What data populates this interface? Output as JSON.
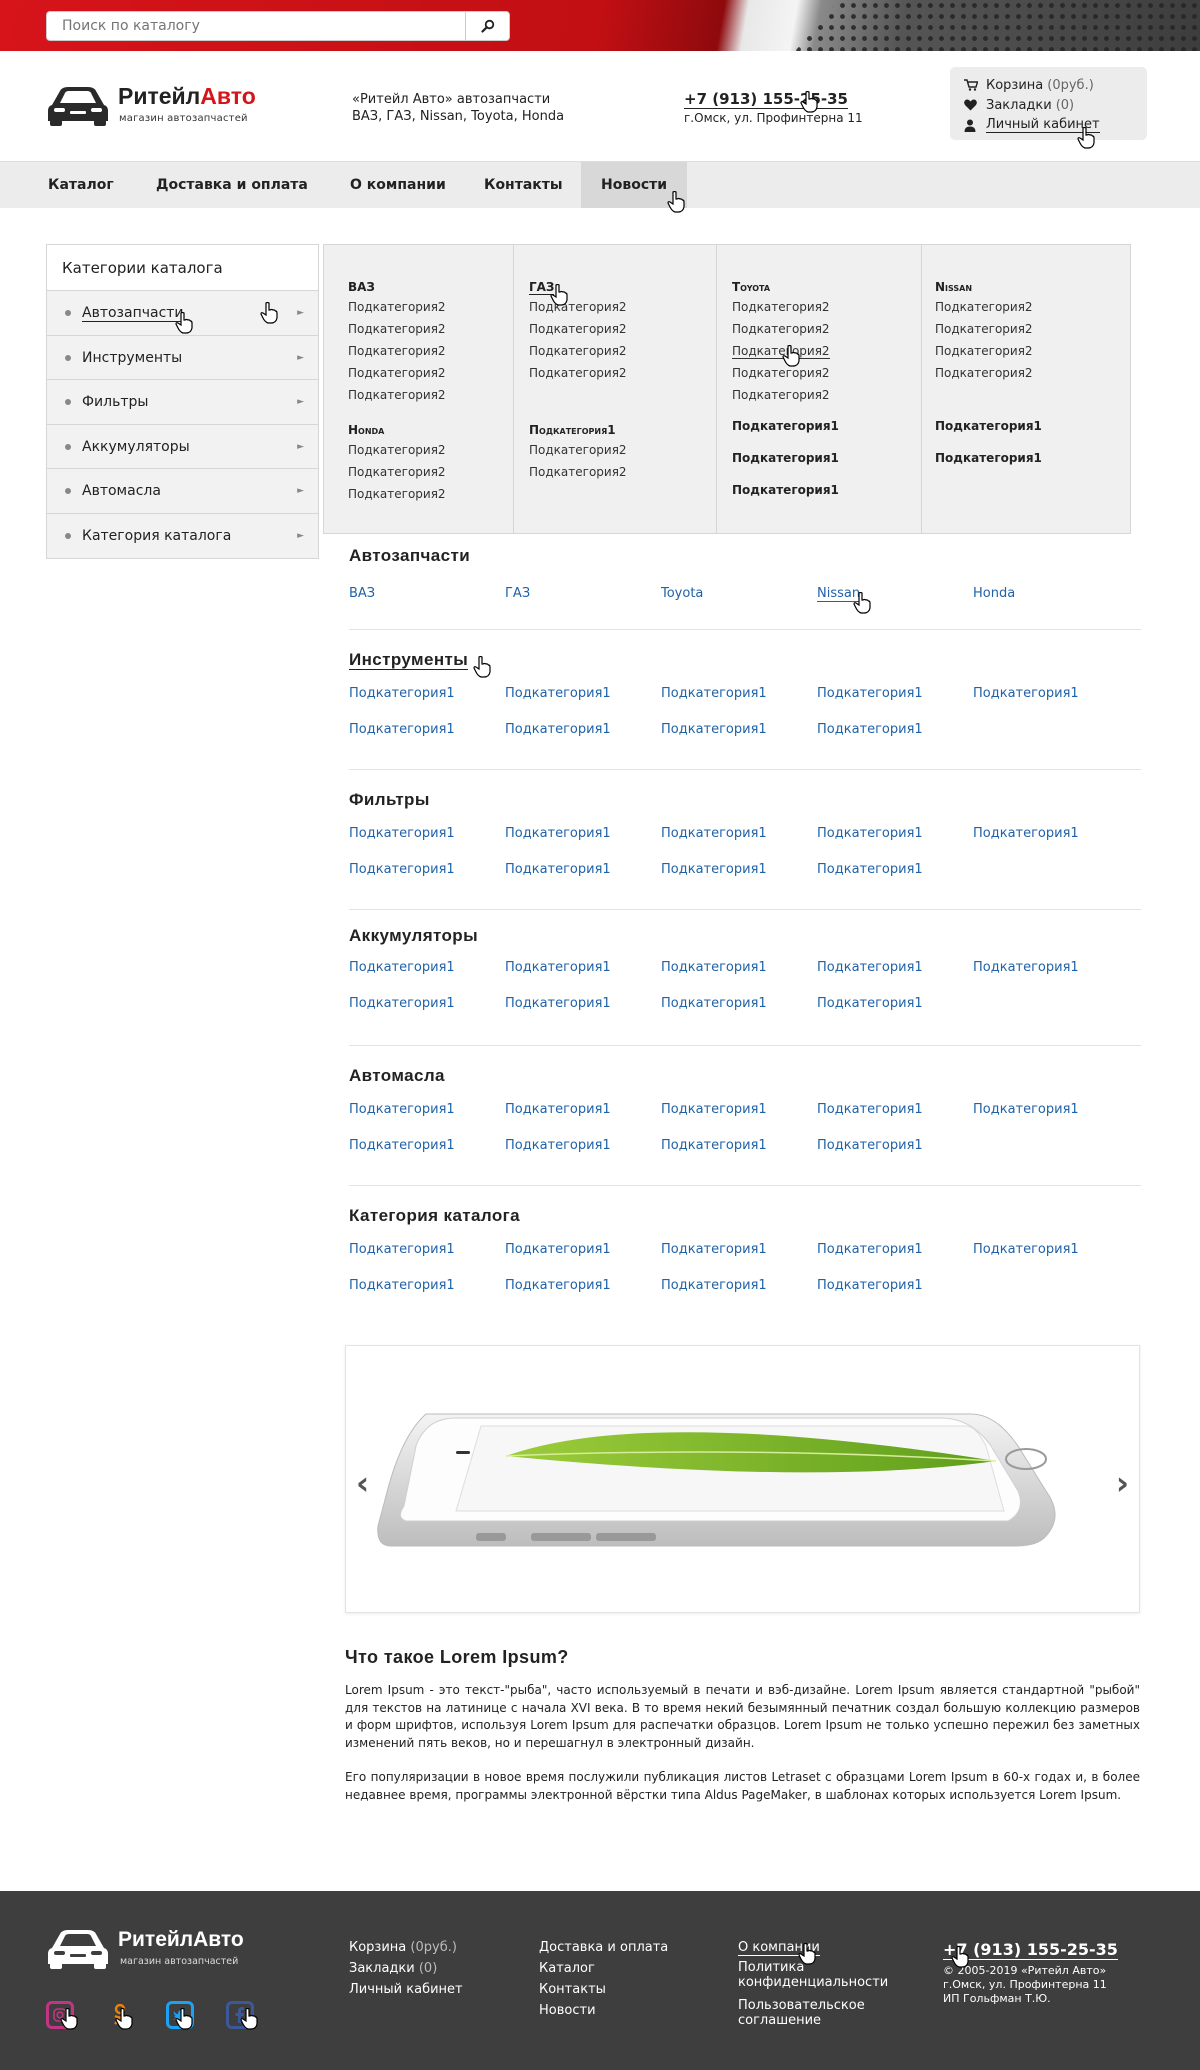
{
  "search": {
    "placeholder": "Поиск по каталогу"
  },
  "brand": {
    "name_black": "Ритейл",
    "name_red": "Авто",
    "tagline": "магазин автозапчастей"
  },
  "header": {
    "about_line1": "«Ритейл Авто» автозапчасти",
    "about_line2": "ВАЗ, ГАЗ, Nissan, Toyota, Honda",
    "phone": "+7 (913) 155-25-35",
    "address": "г.Омск, ул. Профинтерна 11"
  },
  "user": {
    "cart_label": "Корзина",
    "cart_value": "(0руб.)",
    "bookmarks_label": "Закладки",
    "bookmarks_value": "(0)",
    "account_label": "Личный кабинет"
  },
  "nav": [
    "Каталог",
    "Доставка и оплата",
    "О компании",
    "Контакты",
    "Новости"
  ],
  "sidebar": {
    "title": "Категории каталога",
    "items": [
      "Автозапчасти",
      "Инструменты",
      "Фильтры",
      "Аккумуляторы",
      "Автомасла",
      "Категория каталога"
    ]
  },
  "dropdown": {
    "cols": [
      {
        "groups": [
          {
            "title": "ВАЗ",
            "links": [
              "Подкатегория2",
              "Подкатегория2",
              "Подкатегория2",
              "Подкатегория2",
              "Подкатегория2"
            ]
          },
          {
            "title": "Honda",
            "links": [
              "Подкатегория2",
              "Подкатегория2",
              "Подкатегория2"
            ]
          }
        ]
      },
      {
        "groups": [
          {
            "title": "ГАЗ",
            "links": [
              "Подкатегория2",
              "Подкатегория2",
              "Подкатегория2",
              "Подкатегория2"
            ]
          },
          {
            "title": "Подкатегория1",
            "links": [
              "Подкатегория2",
              "Подкатегория2"
            ]
          }
        ]
      },
      {
        "groups": [
          {
            "title": "Toyota",
            "links": [
              "Подкатегория2",
              "Подкатегория2",
              "Подкатегория2",
              "Подкатегория2",
              "Подкатегория2"
            ]
          }
        ],
        "extra": [
          "Подкатегория1",
          "Подкатегория1",
          "Подкатегория1"
        ]
      },
      {
        "groups": [
          {
            "title": "Nissan",
            "links": [
              "Подкатегория2",
              "Подкатегория2",
              "Подкатегория2",
              "Подкатегория2"
            ]
          }
        ],
        "extra": [
          "Подкатегория1",
          "Подкатегория1"
        ]
      }
    ]
  },
  "sections": [
    {
      "title": "Автозапчасти",
      "links": [
        "ВАЗ",
        "ГАЗ",
        "Toyota",
        "Nissan",
        "Honda"
      ]
    },
    {
      "title": "Инструменты",
      "links": [
        "Подкатегория1",
        "Подкатегория1",
        "Подкатегория1",
        "Подкатегория1",
        "Подкатегория1",
        "Подкатегория1",
        "Подкатегория1",
        "Подкатегория1",
        "Подкатегория1"
      ]
    },
    {
      "title": "Фильтры",
      "links": [
        "Подкатегория1",
        "Подкатегория1",
        "Подкатегория1",
        "Подкатегория1",
        "Подкатегория1",
        "Подкатегория1",
        "Подкатегория1",
        "Подкатегория1",
        "Подкатегория1"
      ]
    },
    {
      "title": "Аккумуляторы",
      "links": [
        "Подкатегория1",
        "Подкатегория1",
        "Подкатегория1",
        "Подкатегория1",
        "Подкатегория1",
        "Подкатегория1",
        "Подкатегория1",
        "Подкатегория1",
        "Подкатегория1"
      ]
    },
    {
      "title": "Автомасла",
      "links": [
        "Подкатегория1",
        "Подкатегория1",
        "Подкатегория1",
        "Подкатегория1",
        "Подкатегория1",
        "Подкатегория1",
        "Подкатегория1",
        "Подкатегория1",
        "Подкатегория1"
      ]
    },
    {
      "title": "Категория каталога",
      "links": [
        "Подкатегория1",
        "Подкатегория1",
        "Подкатегория1",
        "Подкатегория1",
        "Подкатегория1",
        "Подкатегория1",
        "Подкатегория1",
        "Подкатегория1",
        "Подкатегория1"
      ]
    }
  ],
  "slider": {
    "prev": "‹",
    "next": "›"
  },
  "about": {
    "title": "Что такое Lorem Ipsum?",
    "p1": "Lorem Ipsum - это текст-\"рыба\", часто используемый в печати и вэб-дизайне. Lorem Ipsum является стандартной \"рыбой\" для текстов на латинице с начала XVI века. В то время некий безымянный печатник создал большую коллекцию размеров и форм шрифтов, используя Lorem Ipsum для распечатки образцов. Lorem Ipsum не только успешно пережил без заметных изменений пять веков, но и перешагнул в электронный дизайн.",
    "p2": "Его популяризации в новое время послужили публикация листов Letraset с образцами Lorem Ipsum в 60-х годах и, в более недавнее время, программы электронной вёрстки типа Aldus PageMaker, в шаблонах которых используется Lorem Ipsum."
  },
  "footer": {
    "brand": "РитейлАвто",
    "tagline": "магазин автозапчастей",
    "col1": {
      "cart_label": "Корзина",
      "cart_value": "(0руб.)",
      "bookmarks_label": "Закладки",
      "bookmarks_value": "(0)",
      "account": "Личный кабинет"
    },
    "col2": [
      "Доставка и оплата",
      "Каталог",
      "Контакты",
      "Новости"
    ],
    "col3": [
      "О компании",
      "Политика конфиденциальности",
      "Пользовательское соглашение"
    ],
    "phone": "+7 (913) 155-25-35",
    "copyright": "© 2005-2019 «Ритейл Авто»",
    "address": "г.Омск, ул. Профинтерна 11",
    "owner": "ИП Гольфман Т.Ю."
  },
  "colors": {
    "accent_red": "#d6141a",
    "link_blue": "#1f62a8",
    "footer_bg": "#3e3e3e",
    "nav_bg": "#ececec"
  },
  "socials": [
    {
      "icon": "instagram-icon",
      "color": "#c13584"
    },
    {
      "icon": "odnoklassniki-icon",
      "color": "#ee8208"
    },
    {
      "icon": "twitter-icon",
      "color": "#1da1f2"
    },
    {
      "icon": "facebook-icon",
      "color": "#3b5998"
    }
  ]
}
